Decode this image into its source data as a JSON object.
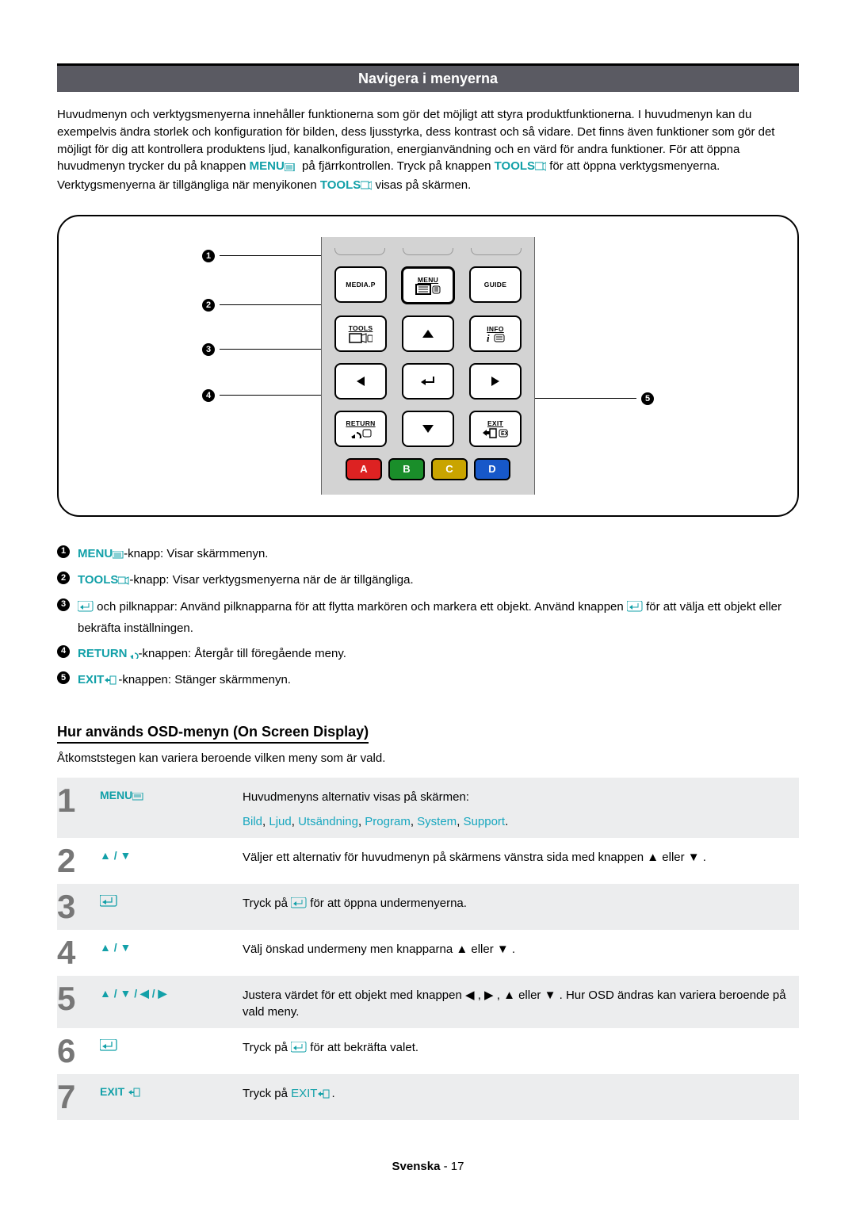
{
  "title": "Navigera i menyerna",
  "intro": {
    "p1a": "Huvudmenyn och verktygsmenyerna innehåller funktionerna som gör det möjligt att styra produktfunktionerna. I huvudmenyn kan du exempelvis ändra storlek och konfiguration för bilden, dess ljusstyrka, dess kontrast och så vidare. Det finns även funktioner som gör det möjligt för dig att kontrollera produktens ljud, kanalkonfiguration, energianvändning och en värd för andra funktioner. För att öppna huvudmenyn trycker du på knappen ",
    "menu_label": "MENU",
    "p1b": " på fjärrkontrollen. Tryck på knappen ",
    "tools_label": "TOOLS",
    "p1c": " för att öppna verktygsmenyerna. Verktygsmenyerna är tillgängliga när menyikonen ",
    "p1d": " visas på skärmen."
  },
  "remote_buttons": {
    "mediap": "MEDIA.P",
    "menu": "MENU",
    "guide": "GUIDE",
    "tools": "TOOLS",
    "info": "INFO",
    "return": "RETURN",
    "exit": "EXIT",
    "A": "A",
    "B": "B",
    "C": "C",
    "D": "D"
  },
  "legend": {
    "1": {
      "label": "MENU",
      "text": "-knapp: Visar skärmmenyn."
    },
    "2": {
      "label": "TOOLS",
      "text": "-knapp: Visar verktygsmenyerna när de är tillgängliga."
    },
    "3": {
      "text_a": " och pilknappar: Använd pilknapparna för att flytta markören och markera ett objekt. Använd knappen ",
      "text_b": " för att välja ett objekt eller bekräfta inställningen."
    },
    "4": {
      "label": "RETURN",
      "text": "-knappen: Återgår till föregående meny."
    },
    "5": {
      "label": "EXIT",
      "text": "-knappen: Stänger skärmmenyn."
    }
  },
  "osd_heading": "Hur används OSD-menyn (On Screen Display)",
  "osd_desc": "Åtkomststegen kan variera beroende vilken meny som är vald.",
  "menu_items": [
    "Bild",
    "Ljud",
    "Utsändning",
    "Program",
    "System",
    "Support"
  ],
  "steps": [
    {
      "n": "1",
      "action": "MENU",
      "desc_a": "Huvudmenyns alternativ visas på skärmen:"
    },
    {
      "n": "2",
      "action": "▲ / ▼",
      "desc": "Väljer ett alternativ för huvudmenyn på skärmens vänstra sida med knappen ▲ eller ▼ ."
    },
    {
      "n": "3",
      "action": "enter",
      "desc_a": "Tryck på ",
      "desc_b": " för att öppna undermenyerna."
    },
    {
      "n": "4",
      "action": "▲ / ▼",
      "desc": "Välj önskad undermeny men knapparna ▲ eller ▼ ."
    },
    {
      "n": "5",
      "action": "▲ / ▼ / ◀ / ▶",
      "desc": "Justera värdet för ett objekt med knappen ◀ , ▶ , ▲ eller ▼ . Hur OSD ändras kan variera beroende på vald meny."
    },
    {
      "n": "6",
      "action": "enter",
      "desc_a": "Tryck på ",
      "desc_b": " för att bekräfta valet."
    },
    {
      "n": "7",
      "action": "EXIT",
      "desc_a": "Tryck på ",
      "desc_b": "EXIT",
      "desc_c": "."
    }
  ],
  "footer": {
    "lang": "Svenska",
    "sep": " - ",
    "page": "17"
  }
}
